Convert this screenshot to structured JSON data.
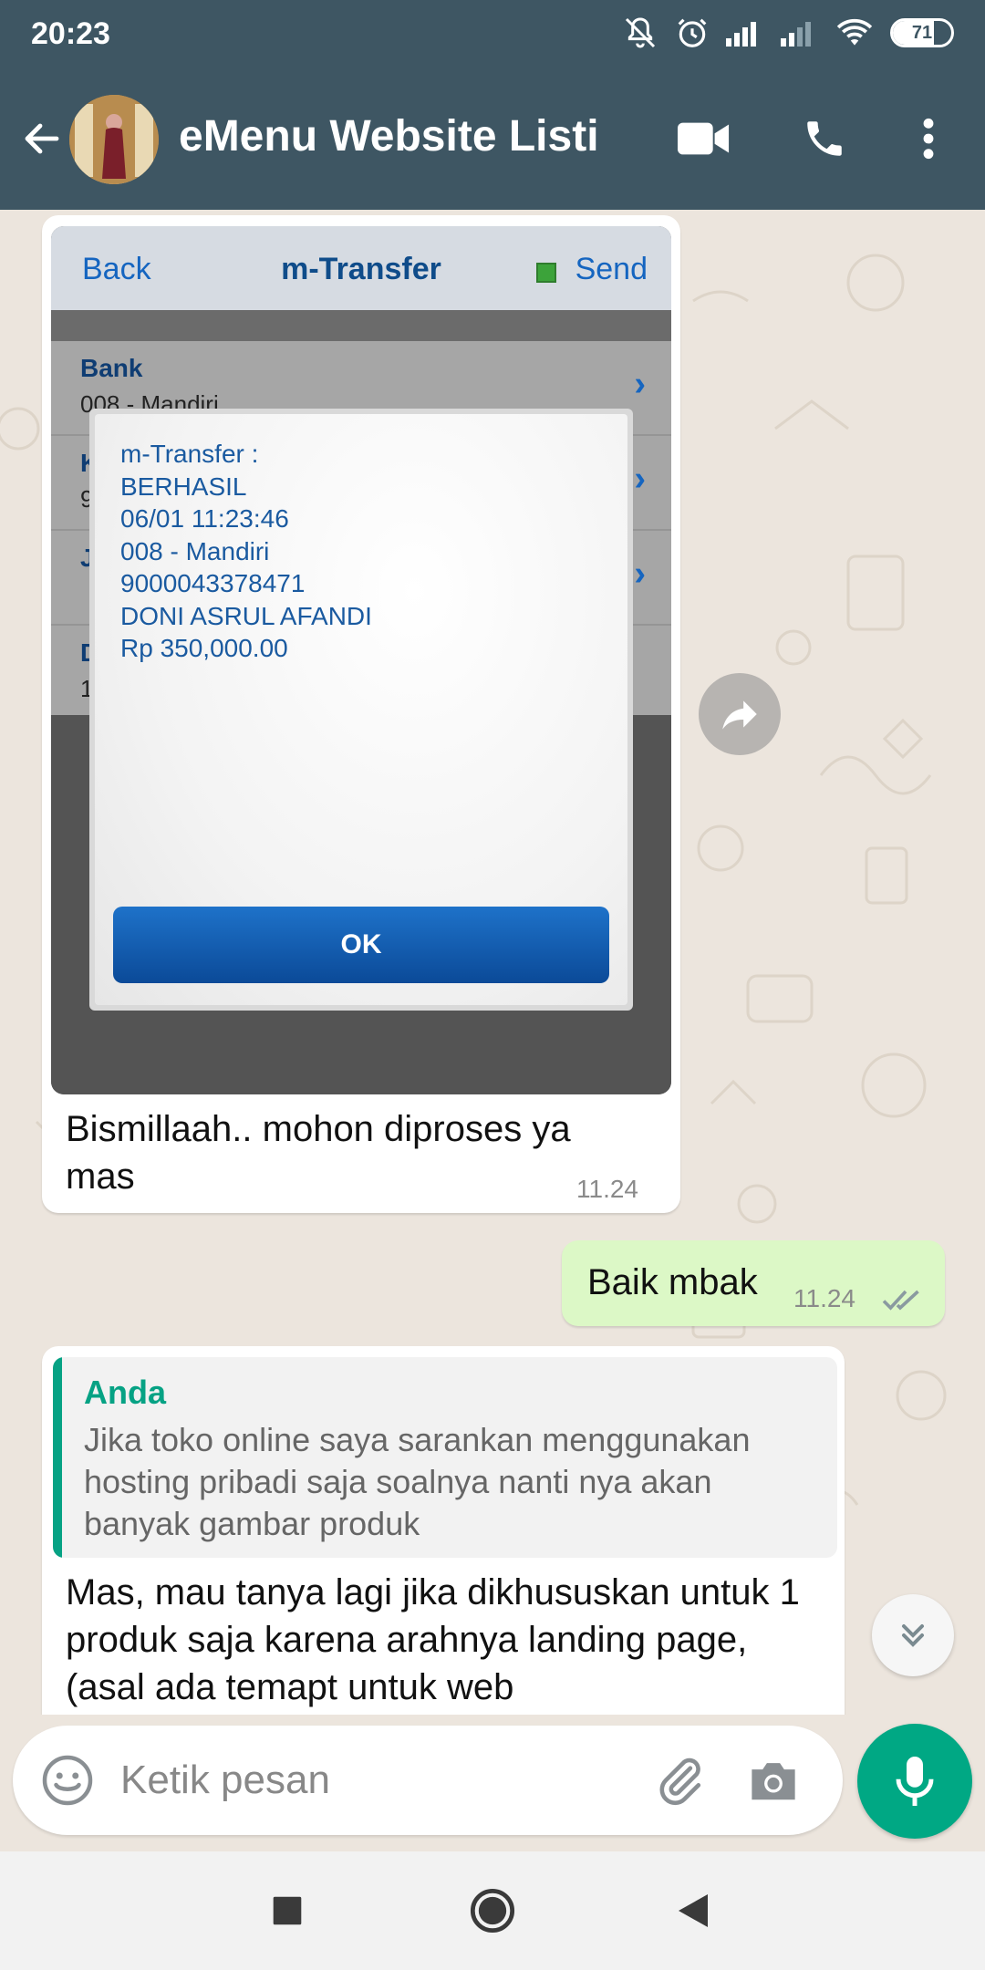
{
  "status_bar": {
    "time": "20:23",
    "battery": "71"
  },
  "header": {
    "contact_name": "eMenu Website Listi"
  },
  "image_message": {
    "screen": {
      "nav_back": "Back",
      "nav_title": "m-Transfer",
      "nav_send": "Send",
      "rows": [
        {
          "label": "Bank",
          "value": "008 - Mandiri"
        },
        {
          "label": "K",
          "value": "9"
        },
        {
          "label": "J",
          "value": ""
        },
        {
          "label": "D",
          "value": "1"
        }
      ],
      "dialog_lines": [
        "m-Transfer :",
        "BERHASIL",
        "06/01 11:23:46",
        "008 - Mandiri",
        "9000043378471",
        "DONI ASRUL AFANDI",
        "Rp 350,000.00"
      ],
      "ok_label": "OK"
    },
    "caption": "Bismillaah.. mohon diproses ya mas",
    "time": "11.24"
  },
  "outgoing_message": {
    "text": "Baik mbak",
    "time": "11.24",
    "status": "read"
  },
  "reply_message": {
    "quote_author": "Anda",
    "quote_text": "Jika toko online saya sarankan menggunakan hosting pribadi saja soalnya nanti nya akan banyak gambar produk",
    "text": "Mas, mau tanya lagi jika dikhususkan untuk 1 produk saja karena arahnya landing page, (asal ada temapt untuk web"
  },
  "input": {
    "placeholder": "Ketik pesan",
    "value": ""
  },
  "colors": {
    "header": "#3e5663",
    "accent": "#00a884",
    "outgoing_bubble": "#dcf8c6",
    "chat_bg": "#ece5dd"
  },
  "icons": {
    "header": [
      "back-arrow-icon",
      "video-call-icon",
      "phone-icon",
      "more-vert-icon"
    ],
    "input": [
      "emoji-icon",
      "attach-icon",
      "camera-icon",
      "mic-icon"
    ],
    "nav": [
      "recents-icon",
      "home-icon",
      "back-icon"
    ]
  }
}
